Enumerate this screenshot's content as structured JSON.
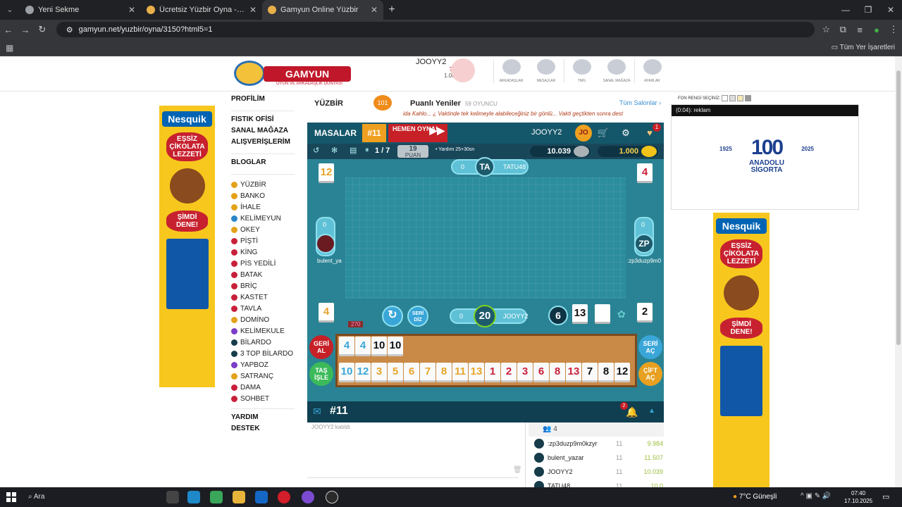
{
  "browser": {
    "tabs": [
      {
        "title": "Yeni Sekme",
        "active": false
      },
      {
        "title": "Ücretsiz Yüzbir Oyna - Salon Li...",
        "active": false
      },
      {
        "title": "Gamyun Online Yüzbir",
        "active": true
      }
    ],
    "url": "gamyun.net/yuzbir/oyna/3150?html5=1",
    "bookmarks_all": "Tüm Yer İşaretleri"
  },
  "header": {
    "logo": "GAMYUN",
    "logo_sub": "OYUN VE ARKADAŞLIK DÜNYASI",
    "username": "JOOYY2",
    "u_badge": "? U",
    "coins": "1.000",
    "nav": [
      "ARKADAŞLAR",
      "MESAJLAR",
      "TMG",
      "SANAL MAĞAZA",
      "AYARLAR"
    ]
  },
  "left_menu": {
    "top": [
      "PROFİLİM",
      "FISTIK OFİSİ",
      "SANAL MAĞAZA",
      "ALIŞVERİŞLERİM"
    ],
    "blog": "BLOGLAR",
    "games": [
      "YÜZBİR",
      "BANKO",
      "İHALE",
      "KELİMEYUN",
      "OKEY",
      "PİŞTİ",
      "KİNG",
      "PİS YEDİLİ",
      "BATAK",
      "BRİÇ",
      "KASTET",
      "TAVLA",
      "DOMİNO",
      "KELİMEKULE",
      "BİLARDO",
      "3 TOP BİLARDO",
      "YAPBOZ",
      "SATRANÇ",
      "DAMA",
      "SOHBET"
    ],
    "bottom": [
      "YARDIM",
      "DESTEK"
    ]
  },
  "ad": {
    "brand": "Nesquik",
    "slogan": "EŞSİZ ÇİKOLATA LEZZETİ",
    "cta": "ŞİMDİ DENE!"
  },
  "game_header": {
    "title": "YÜZBİR",
    "tile": "101",
    "puanli": "Puanlı Yeniler",
    "players": "59 OYUNCU",
    "all_rooms": "Tüm Salonlar ›",
    "ticker": "ida Kahlo... ¿ Vaktinde tek kelimeyle alabileceğiniz bir gönlü... Vakti geçtikten sonra dest"
  },
  "board": {
    "masalar": "MASALAR",
    "room": "#11",
    "hemen": "HEMEN OYNA!",
    "me": "JOOYY2",
    "me_av": "JO",
    "notif": "1",
    "round": "1 / 7",
    "puan_val": "19",
    "puan_lbl": "PUAN",
    "yardim": "• Yardım 25+30sn",
    "balance1": "10.039",
    "balance2": "1.000",
    "top_player": {
      "name": "TATU48",
      "initials": "TA",
      "score": "0",
      "tile": "4"
    },
    "left_player": {
      "name": "bulent_ya",
      "score": "0",
      "tile": "12"
    },
    "right_player": {
      "name": ":zp3duzp9m0",
      "initials": "ZP",
      "score": "0",
      "tile": "4"
    },
    "me_player": {
      "name": "JOOYY2",
      "timer": "20",
      "score": "0",
      "tile": "4",
      "points": "270"
    },
    "seri_diz": "SERİ DİZ",
    "center": {
      "okey": "6",
      "indicator": "13",
      "right_tile": "2"
    },
    "rack_top": [
      {
        "v": "4",
        "c": "#3aa6d8"
      },
      {
        "v": "4",
        "c": "#3aa6d8"
      },
      {
        "v": "10",
        "c": "#111"
      },
      {
        "v": "10",
        "c": "#111"
      }
    ],
    "rack_bottom": [
      {
        "v": "10",
        "c": "#3aa6d8"
      },
      {
        "v": "12",
        "c": "#3aa6d8"
      },
      {
        "v": "3",
        "c": "#e6a42a"
      },
      {
        "v": "5",
        "c": "#e6a42a"
      },
      {
        "v": "6",
        "c": "#e6a42a"
      },
      {
        "v": "7",
        "c": "#e6a42a"
      },
      {
        "v": "8",
        "c": "#e6a42a"
      },
      {
        "v": "11",
        "c": "#e6a42a"
      },
      {
        "v": "13",
        "c": "#e6a42a"
      },
      {
        "v": "1",
        "c": "#c8203a"
      },
      {
        "v": "2",
        "c": "#c8203a"
      },
      {
        "v": "3",
        "c": "#c8203a"
      },
      {
        "v": "6",
        "c": "#c8203a"
      },
      {
        "v": "8",
        "c": "#c8203a"
      },
      {
        "v": "13",
        "c": "#c8203a"
      },
      {
        "v": "7",
        "c": "#111"
      },
      {
        "v": "8",
        "c": "#111"
      },
      {
        "v": "12",
        "c": "#111"
      }
    ],
    "btn_geri": "GERİ AL",
    "btn_tas": "TAŞ İŞLE",
    "btn_seri": "SERİ AÇ",
    "btn_cift": "ÇİFT AÇ",
    "chat_room": "#11",
    "chat_badge": "2"
  },
  "chat": {
    "line": "JOOYY2 katıldı"
  },
  "players_list": {
    "count": "4",
    "rows": [
      {
        "name": ":zp3duzp9m0kzyr",
        "lvl": "11",
        "score": "9.984"
      },
      {
        "name": "bulent_yazar",
        "lvl": "11",
        "score": "11.507"
      },
      {
        "name": "JOOYY2",
        "lvl": "11",
        "score": "10.039"
      },
      {
        "name": "TATU48",
        "lvl": "11",
        "score": "10.0"
      }
    ]
  },
  "right": {
    "fon": "FON RENGİ SEÇİNİZ:",
    "video_bar": "(0:04): reklam",
    "sponsor_years_l": "1925",
    "sponsor_years_r": "2025",
    "sponsor_big": "100",
    "sponsor_name1": "ANADOLU",
    "sponsor_name2": "SİGORTA"
  },
  "taskbar": {
    "search": "Ara",
    "weather": "7°C Güneşli",
    "time": "07:40",
    "date": "17.10.2025"
  }
}
